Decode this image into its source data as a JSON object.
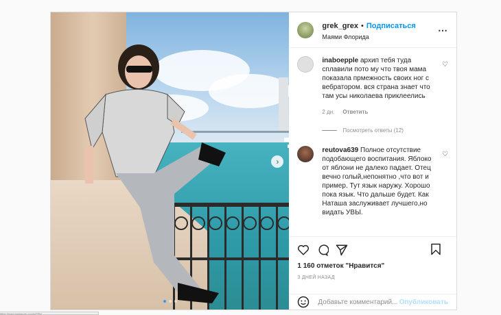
{
  "post": {
    "username": "grek_grex",
    "separator": "•",
    "follow_label": "Подписаться",
    "location": "Маями Флорида",
    "more_icon": "⋯"
  },
  "comments": [
    {
      "username": "inaboepple",
      "text": "архип тебя туда сплавили пото му что твоя мама показала прмежность своих ног с вебратором. вся страна знает что там усы николаева приклеелись",
      "time": "2 дн.",
      "reply_label": "Ответить"
    },
    {
      "username": "reutova639",
      "text": "Полное отсутствие подобающего воспитания. Яблоко от яблони не далеко падает. Отец вечно голый,непонятно ,что вот и пример. Тут язык наружу. Хорошо пока язык. Что дальше будет. Как Наташа заслуживает лучшего,но видать УВЫ."
    }
  ],
  "view_replies": "Посмотреть ответы (12)",
  "likes": "1 160 отметок \"Нравится\"",
  "date": "3 ДНЕЙ НАЗАД",
  "add_comment": {
    "placeholder": "Добавьте комментарий...",
    "publish_label": "Опубликовать"
  },
  "carousel": {
    "total": 3,
    "current": 1
  },
  "statusbar_text": "https://www.instagram.com/p/CBsl...",
  "colors": {
    "accent": "#0095f6",
    "muted": "#8e8e8e",
    "border": "#dbdbdb"
  }
}
